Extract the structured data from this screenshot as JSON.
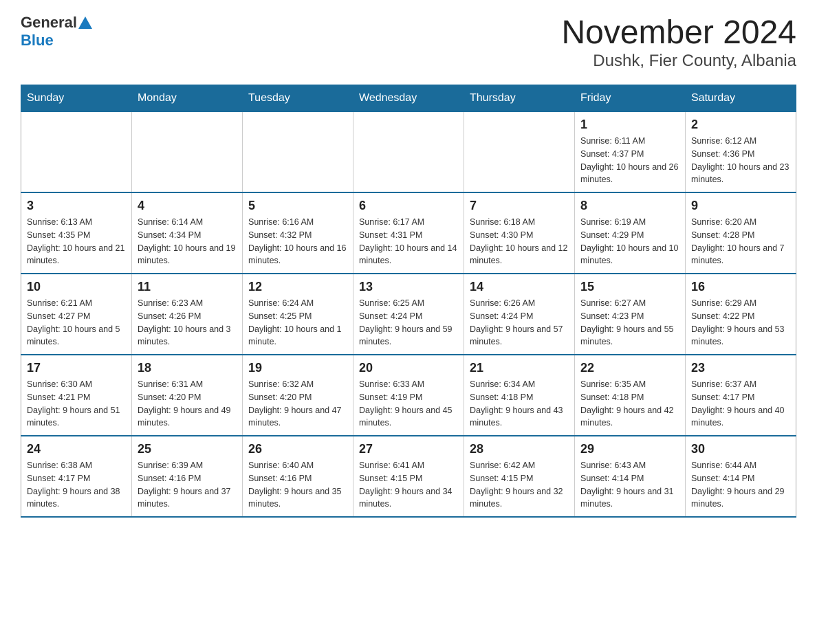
{
  "header": {
    "logo": {
      "general": "General",
      "blue": "Blue"
    },
    "title": "November 2024",
    "subtitle": "Dushk, Fier County, Albania"
  },
  "days_of_week": [
    "Sunday",
    "Monday",
    "Tuesday",
    "Wednesday",
    "Thursday",
    "Friday",
    "Saturday"
  ],
  "weeks": [
    {
      "days": [
        {
          "number": "",
          "info": ""
        },
        {
          "number": "",
          "info": ""
        },
        {
          "number": "",
          "info": ""
        },
        {
          "number": "",
          "info": ""
        },
        {
          "number": "",
          "info": ""
        },
        {
          "number": "1",
          "info": "Sunrise: 6:11 AM\nSunset: 4:37 PM\nDaylight: 10 hours and 26 minutes."
        },
        {
          "number": "2",
          "info": "Sunrise: 6:12 AM\nSunset: 4:36 PM\nDaylight: 10 hours and 23 minutes."
        }
      ]
    },
    {
      "days": [
        {
          "number": "3",
          "info": "Sunrise: 6:13 AM\nSunset: 4:35 PM\nDaylight: 10 hours and 21 minutes."
        },
        {
          "number": "4",
          "info": "Sunrise: 6:14 AM\nSunset: 4:34 PM\nDaylight: 10 hours and 19 minutes."
        },
        {
          "number": "5",
          "info": "Sunrise: 6:16 AM\nSunset: 4:32 PM\nDaylight: 10 hours and 16 minutes."
        },
        {
          "number": "6",
          "info": "Sunrise: 6:17 AM\nSunset: 4:31 PM\nDaylight: 10 hours and 14 minutes."
        },
        {
          "number": "7",
          "info": "Sunrise: 6:18 AM\nSunset: 4:30 PM\nDaylight: 10 hours and 12 minutes."
        },
        {
          "number": "8",
          "info": "Sunrise: 6:19 AM\nSunset: 4:29 PM\nDaylight: 10 hours and 10 minutes."
        },
        {
          "number": "9",
          "info": "Sunrise: 6:20 AM\nSunset: 4:28 PM\nDaylight: 10 hours and 7 minutes."
        }
      ]
    },
    {
      "days": [
        {
          "number": "10",
          "info": "Sunrise: 6:21 AM\nSunset: 4:27 PM\nDaylight: 10 hours and 5 minutes."
        },
        {
          "number": "11",
          "info": "Sunrise: 6:23 AM\nSunset: 4:26 PM\nDaylight: 10 hours and 3 minutes."
        },
        {
          "number": "12",
          "info": "Sunrise: 6:24 AM\nSunset: 4:25 PM\nDaylight: 10 hours and 1 minute."
        },
        {
          "number": "13",
          "info": "Sunrise: 6:25 AM\nSunset: 4:24 PM\nDaylight: 9 hours and 59 minutes."
        },
        {
          "number": "14",
          "info": "Sunrise: 6:26 AM\nSunset: 4:24 PM\nDaylight: 9 hours and 57 minutes."
        },
        {
          "number": "15",
          "info": "Sunrise: 6:27 AM\nSunset: 4:23 PM\nDaylight: 9 hours and 55 minutes."
        },
        {
          "number": "16",
          "info": "Sunrise: 6:29 AM\nSunset: 4:22 PM\nDaylight: 9 hours and 53 minutes."
        }
      ]
    },
    {
      "days": [
        {
          "number": "17",
          "info": "Sunrise: 6:30 AM\nSunset: 4:21 PM\nDaylight: 9 hours and 51 minutes."
        },
        {
          "number": "18",
          "info": "Sunrise: 6:31 AM\nSunset: 4:20 PM\nDaylight: 9 hours and 49 minutes."
        },
        {
          "number": "19",
          "info": "Sunrise: 6:32 AM\nSunset: 4:20 PM\nDaylight: 9 hours and 47 minutes."
        },
        {
          "number": "20",
          "info": "Sunrise: 6:33 AM\nSunset: 4:19 PM\nDaylight: 9 hours and 45 minutes."
        },
        {
          "number": "21",
          "info": "Sunrise: 6:34 AM\nSunset: 4:18 PM\nDaylight: 9 hours and 43 minutes."
        },
        {
          "number": "22",
          "info": "Sunrise: 6:35 AM\nSunset: 4:18 PM\nDaylight: 9 hours and 42 minutes."
        },
        {
          "number": "23",
          "info": "Sunrise: 6:37 AM\nSunset: 4:17 PM\nDaylight: 9 hours and 40 minutes."
        }
      ]
    },
    {
      "days": [
        {
          "number": "24",
          "info": "Sunrise: 6:38 AM\nSunset: 4:17 PM\nDaylight: 9 hours and 38 minutes."
        },
        {
          "number": "25",
          "info": "Sunrise: 6:39 AM\nSunset: 4:16 PM\nDaylight: 9 hours and 37 minutes."
        },
        {
          "number": "26",
          "info": "Sunrise: 6:40 AM\nSunset: 4:16 PM\nDaylight: 9 hours and 35 minutes."
        },
        {
          "number": "27",
          "info": "Sunrise: 6:41 AM\nSunset: 4:15 PM\nDaylight: 9 hours and 34 minutes."
        },
        {
          "number": "28",
          "info": "Sunrise: 6:42 AM\nSunset: 4:15 PM\nDaylight: 9 hours and 32 minutes."
        },
        {
          "number": "29",
          "info": "Sunrise: 6:43 AM\nSunset: 4:14 PM\nDaylight: 9 hours and 31 minutes."
        },
        {
          "number": "30",
          "info": "Sunrise: 6:44 AM\nSunset: 4:14 PM\nDaylight: 9 hours and 29 minutes."
        }
      ]
    }
  ]
}
